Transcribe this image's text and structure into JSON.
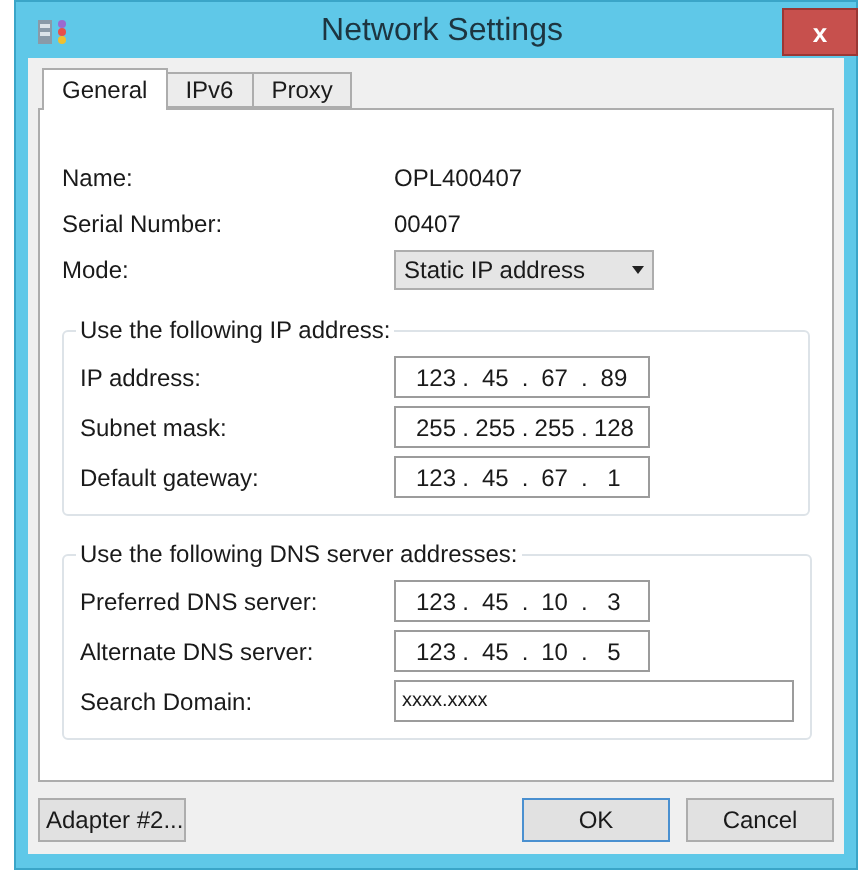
{
  "window": {
    "title": "Network Settings",
    "close": "x"
  },
  "tabs": [
    {
      "label": "General",
      "selected": true
    },
    {
      "label": "IPv6",
      "selected": false
    },
    {
      "label": "Proxy",
      "selected": false
    }
  ],
  "info": [
    {
      "label": "Name:",
      "value": "OPL400407"
    },
    {
      "label": "Serial Number:",
      "value": "00407"
    }
  ],
  "mode": {
    "label": "Mode:",
    "value": "Static IP address"
  },
  "groups": [
    {
      "title": "Use the following IP address:",
      "fields": [
        {
          "label": "IP address:",
          "octets": [
            "123",
            "45",
            "67",
            "89"
          ]
        },
        {
          "label": "Subnet mask:",
          "octets": [
            "255",
            "255",
            "255",
            "128"
          ]
        },
        {
          "label": "Default gateway:",
          "octets": [
            "123",
            "45",
            "67",
            "1"
          ]
        }
      ]
    },
    {
      "title": "Use the following DNS server addresses:",
      "fields": [
        {
          "label": "Preferred DNS server:",
          "octets": [
            "123",
            "45",
            "10",
            "3"
          ]
        },
        {
          "label": "Alternate DNS server:",
          "octets": [
            "123",
            "45",
            "10",
            "5"
          ]
        },
        {
          "label": "Search Domain:",
          "value": "xxxx.xxxx"
        }
      ]
    }
  ],
  "separator": ".",
  "buttons": {
    "left": "Adapter #2...",
    "ok": "OK",
    "cancel": "Cancel"
  }
}
